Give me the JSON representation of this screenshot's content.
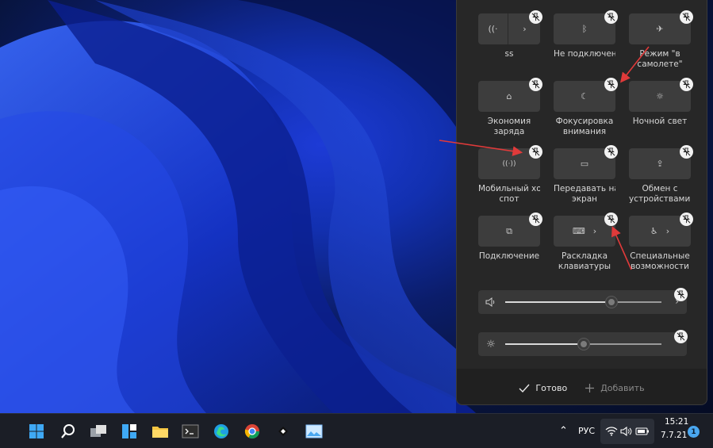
{
  "tiles": [
    {
      "id": "wifi",
      "label_lines": [
        "ss"
      ],
      "icon": "wifi-icon",
      "glyph": "((·",
      "chevron": "›"
    },
    {
      "id": "bluetooth",
      "label_lines": [
        "Не подключено"
      ],
      "icon": "bluetooth-icon",
      "glyph": "ᛒ"
    },
    {
      "id": "airplane",
      "label_lines": [
        "Режим \"в",
        "самолете\""
      ],
      "icon": "airplane-icon",
      "glyph": "✈"
    },
    {
      "id": "battery-saver",
      "label_lines": [
        "Экономия",
        "заряда"
      ],
      "icon": "battery-saver-icon",
      "glyph": "⌂"
    },
    {
      "id": "focus",
      "label_lines": [
        "Фокусировка",
        "внимания"
      ],
      "icon": "moon-icon",
      "glyph": "☾"
    },
    {
      "id": "night-light",
      "label_lines": [
        "Ночной свет"
      ],
      "icon": "sun-icon",
      "glyph": "☼"
    },
    {
      "id": "hotspot",
      "label_lines": [
        "Мобильный хот-",
        "спот"
      ],
      "icon": "hotspot-icon",
      "glyph": "((·))"
    },
    {
      "id": "cast",
      "label_lines": [
        "Передавать на",
        "экран"
      ],
      "icon": "cast-icon",
      "glyph": "▭"
    },
    {
      "id": "nearby-share",
      "label_lines": [
        "Обмен с",
        "устройствами по"
      ],
      "icon": "share-icon",
      "glyph": "⇪"
    },
    {
      "id": "connect",
      "label_lines": [
        "Подключение"
      ],
      "icon": "connect-icon",
      "glyph": "⧉"
    },
    {
      "id": "keyboard-layout",
      "label_lines": [
        "Раскладка",
        "клавиатуры"
      ],
      "icon": "keyboard-icon",
      "glyph": "⌨",
      "chevron": "›"
    },
    {
      "id": "accessibility",
      "label_lines": [
        "Специальные",
        "возможности"
      ],
      "icon": "accessibility-icon",
      "glyph": "♿",
      "chevron": "›"
    }
  ],
  "sliders": {
    "volume": {
      "icon": "speaker-icon",
      "glyph": "🔈",
      "level": 0.68,
      "chevron": "›"
    },
    "brightness": {
      "icon": "brightness-icon",
      "glyph": "☼",
      "level": 0.5
    }
  },
  "footer": {
    "done_label": "Готово",
    "add_label": "Добавить"
  },
  "taskbar": {
    "apps": [
      "start-icon",
      "search-icon",
      "task-view-icon",
      "widgets-icon",
      "file-explorer-icon",
      "terminal-icon",
      "edge-icon",
      "chrome-icon",
      "app-icon",
      "photos-icon"
    ],
    "language": "РУС",
    "time": "15:21",
    "date": "7.7.21",
    "notification_count": "1"
  },
  "colors": {
    "accent_arrow": "#e03a3a",
    "panel_bg": "#202020",
    "tile_bg": "#3d3d3d",
    "taskbar_bg": "#1b1e26"
  }
}
